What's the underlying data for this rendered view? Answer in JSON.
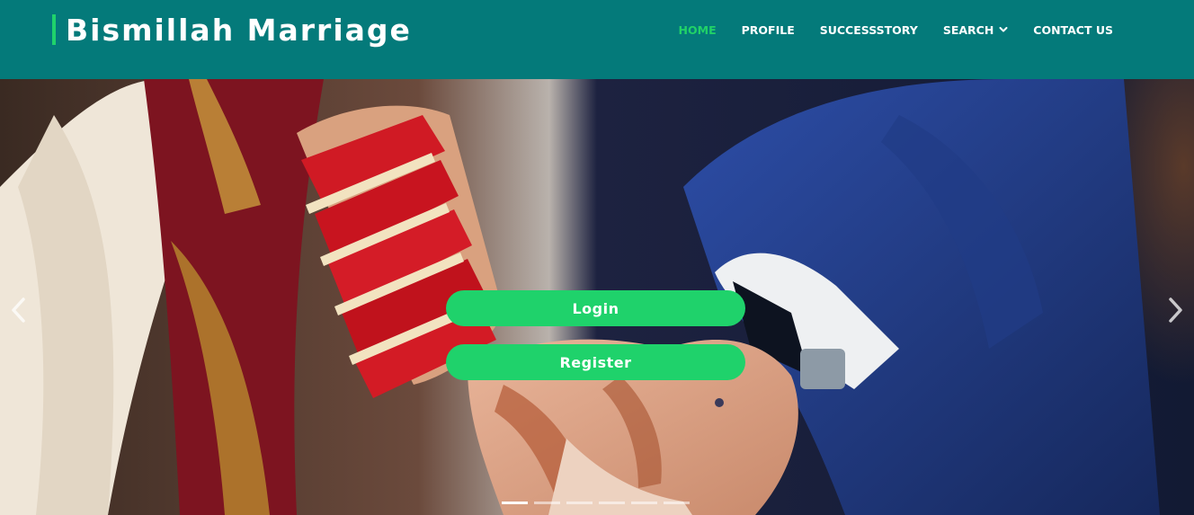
{
  "header": {
    "brand": "Bismillah Marriage",
    "nav": [
      {
        "label": "HOME",
        "active": true
      },
      {
        "label": "PROFILE"
      },
      {
        "label": "SUCCESSSTORY"
      },
      {
        "label": "SEARCH",
        "icon": "chevron-down-icon"
      },
      {
        "label": "CONTACT US"
      }
    ]
  },
  "hero": {
    "image": "wedding couple holding hands",
    "login_label": "Login",
    "register_label": "Register",
    "prev_icon": "chevron-left-icon",
    "next_icon": "chevron-right-icon",
    "slides_count": 6,
    "active_slide": 1
  },
  "colors": {
    "header_bg": "#047a7a",
    "accent": "#1fd26b",
    "text": "#ffffff"
  }
}
